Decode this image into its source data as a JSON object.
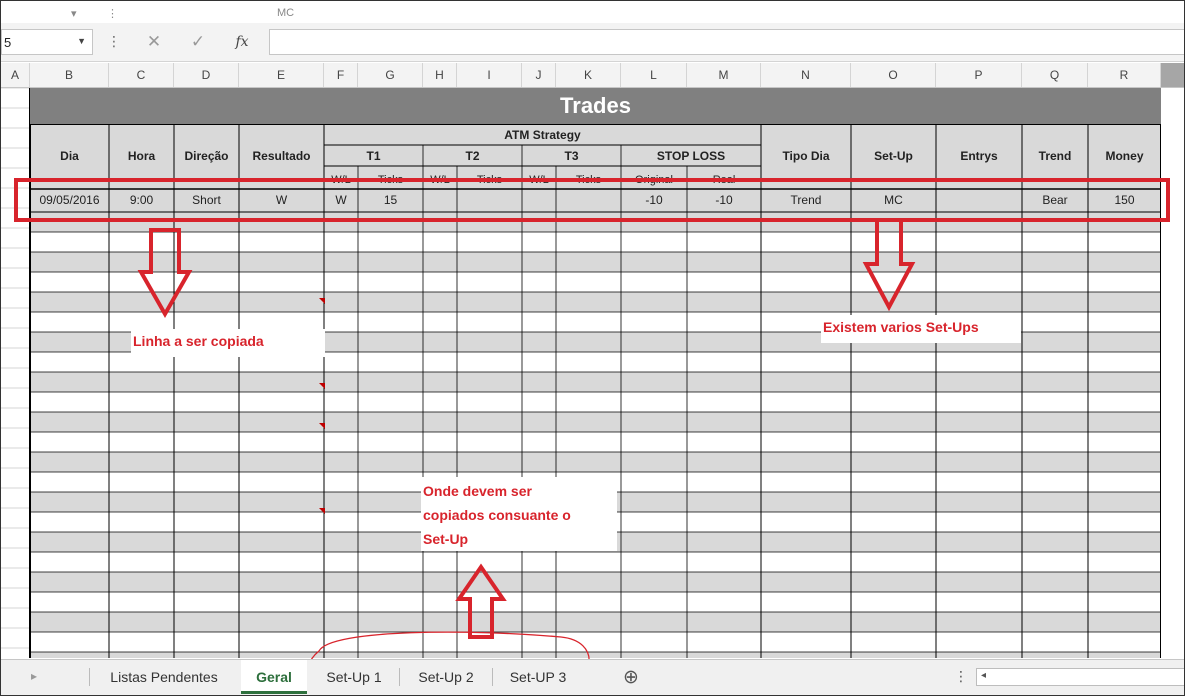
{
  "formula_bar": {
    "name_box": "5",
    "cancel_glyph": "✕",
    "enter_glyph": "✓",
    "fx_label": "fx",
    "ghost_text": "MC"
  },
  "column_letters": [
    "A",
    "B",
    "C",
    "D",
    "E",
    "F",
    "G",
    "H",
    "I",
    "J",
    "K",
    "L",
    "M",
    "N",
    "O",
    "P",
    "Q",
    "R"
  ],
  "table": {
    "title": "Trades",
    "atm_strategy": "ATM Strategy",
    "headers": {
      "dia": "Dia",
      "hora": "Hora",
      "direcao": "Direção",
      "resultado": "Resultado",
      "t1": "T1",
      "t2": "T2",
      "t3": "T3",
      "stop_loss": "STOP LOSS",
      "tipo_dia": "Tipo Dia",
      "setup": "Set-Up",
      "entrys": "Entrys",
      "trend": "Trend",
      "money": "Money"
    },
    "sub_headers": {
      "wl": "W/L",
      "ticks": "Ticks",
      "original": "Original",
      "real": "Real"
    },
    "row": {
      "dia": "09/05/2016",
      "hora": "9:00",
      "direcao": "Short",
      "resultado": "W",
      "t1_wl": "W",
      "t1_ticks": "15",
      "sl_original": "-10",
      "sl_real": "-10",
      "tipo_dia": "Trend",
      "setup": "MC",
      "trend": "Bear",
      "money": "150"
    }
  },
  "annotations": {
    "linha": "Linha a ser copiada",
    "existem": "Existem varios Set-Ups",
    "onde_l1": "Onde devem ser",
    "onde_l2": "copiados consuante o",
    "onde_l3": "Set-Up"
  },
  "sheet_tabs": [
    "Listas Pendentes",
    "Geral",
    "Set-Up 1",
    "Set-Up 2",
    "Set-UP 3"
  ],
  "active_tab": "Geral",
  "colors": {
    "header_gray": "#808080",
    "band_gray": "#d9d9d9",
    "annotation_red": "#d8242c",
    "tab_green": "#2d6f3c"
  }
}
